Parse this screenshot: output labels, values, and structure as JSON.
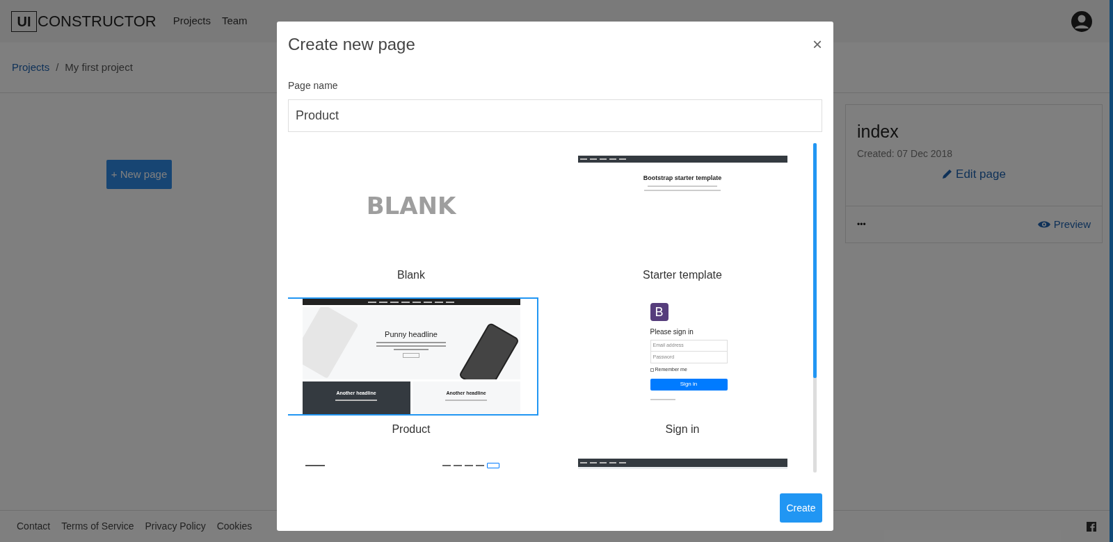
{
  "header": {
    "logo_mark": "UI",
    "logo_text": "CONSTRUCTOR",
    "nav": [
      "Projects",
      "Team"
    ]
  },
  "breadcrumb": {
    "link": "Projects",
    "separator": "/",
    "current": "My first project"
  },
  "new_page_button": "+ New page",
  "page_card": {
    "title": "index",
    "created": "Created: 07 Dec 2018",
    "edit": "Edit page",
    "more": "•••",
    "preview": "Preview"
  },
  "footer": {
    "links": [
      "Contact",
      "Terms of Service",
      "Privacy Policy",
      "Cookies"
    ]
  },
  "modal": {
    "title": "Create new page",
    "close": "×",
    "field_label": "Page name",
    "field_value": "Product",
    "templates": [
      {
        "kind": "blank",
        "label": "Blank",
        "selected": false,
        "texts": [
          "BLANK"
        ]
      },
      {
        "kind": "starter",
        "label": "Starter template",
        "selected": false,
        "texts": [
          "Bootstrap starter template"
        ]
      },
      {
        "kind": "product",
        "label": "Product",
        "selected": true,
        "texts": [
          "Punny headline",
          "Another headline",
          "Another headline"
        ]
      },
      {
        "kind": "signin",
        "label": "Sign in",
        "selected": false,
        "texts": [
          "B",
          "Please sign in",
          "Email address",
          "Password",
          "Remember me",
          "Sign in"
        ]
      },
      {
        "kind": "pricing",
        "selected": false
      },
      {
        "kind": "navbar",
        "selected": false
      }
    ],
    "create_button": "Create"
  }
}
